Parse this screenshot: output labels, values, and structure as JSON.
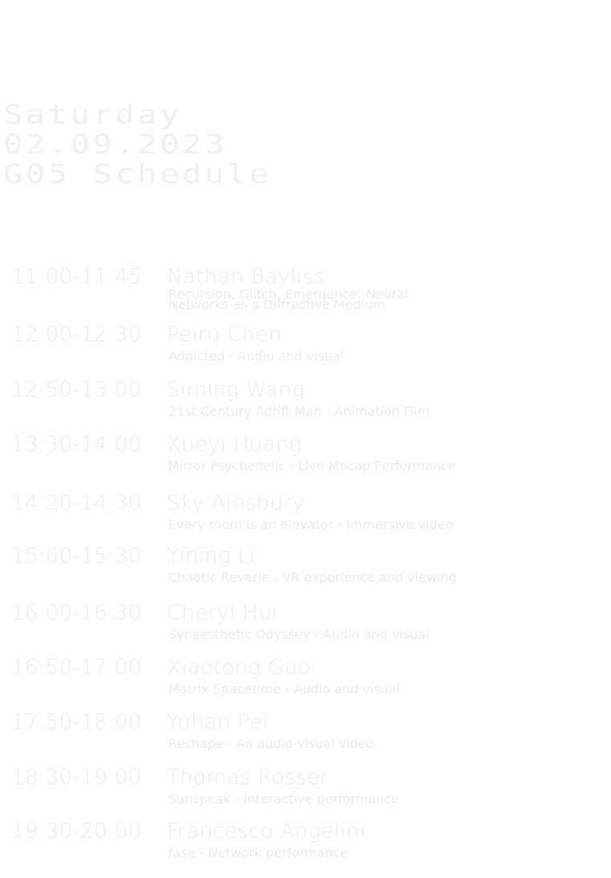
{
  "header": {
    "day": "Saturday",
    "date": "02.09.2023",
    "title": "G05 Schedule"
  },
  "schedule": [
    {
      "time": "11:00-11:45",
      "name": "Nathan Bayliss",
      "work": "Recursion, Glitch, Emergence: Neural Networks as a Diffractive Medium"
    },
    {
      "time": "12:00-12:30",
      "name": "Peiru Chen",
      "work": "Addicted - Audio and visual"
    },
    {
      "time": "12:50-13:00",
      "name": "Siming Wang",
      "work": "21st Century Adrift Man - Animation Film"
    },
    {
      "time": "13:30-14:00",
      "name": "Xueyi Huang",
      "work": "Mirror Psychedelic - Live Mocap Performance"
    },
    {
      "time": "14:20-14:30",
      "name": "Sky Ainsbury",
      "work": "Every room is an elevator - Immersive video"
    },
    {
      "time": "15:00-15:30",
      "name": "Yining Li",
      "work": "Chaotic Reverie - VR experience and viewing"
    },
    {
      "time": "16:00-16:30",
      "name": "Cheryl Hui",
      "work": "Synaesthetic Odyssey - Audio and visual"
    },
    {
      "time": "16:50-17:00",
      "name": "Xiaotong Guo",
      "work": "Matrix Spacetime - Audio and visual"
    },
    {
      "time": "17:50-18:00",
      "name": "Yuhan Pei",
      "work": "Reshape - An audio-visual video"
    },
    {
      "time": "18:30-19:00",
      "name": "Thomas Rosser",
      "work": "Sunspeak - Interactive performance"
    },
    {
      "time": "19:30-20:00",
      "name": "Francesco Angelini",
      "work": "fase - Network performance"
    }
  ]
}
